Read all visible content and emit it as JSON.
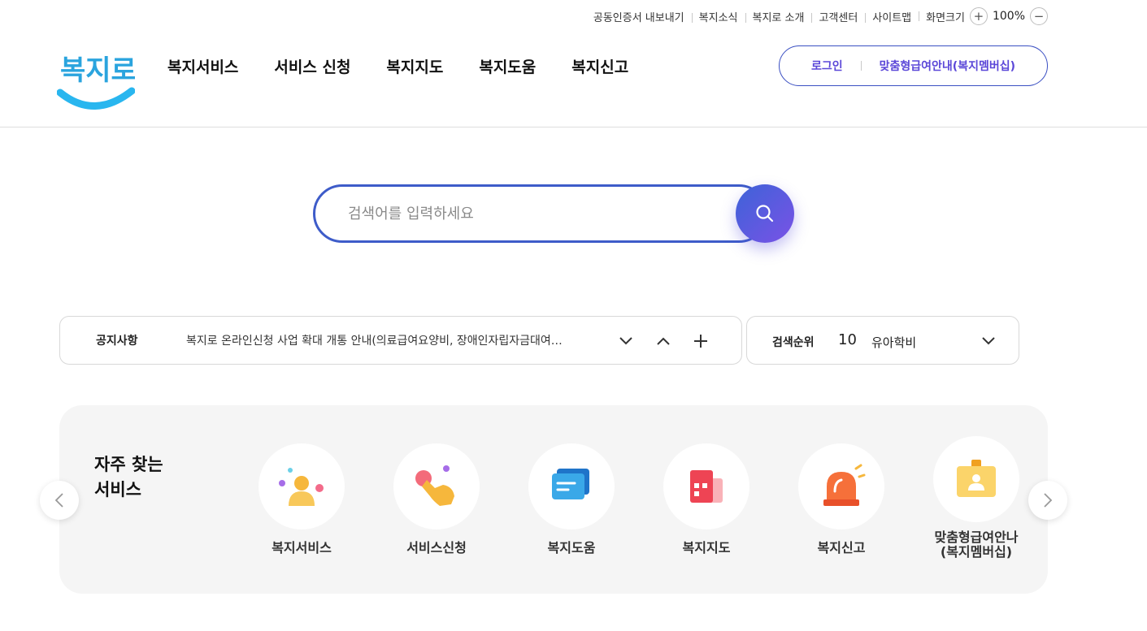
{
  "utility": {
    "items": [
      "공동인증서 내보내기",
      "복지소식",
      "복지로 소개",
      "고객센터",
      "사이트맵"
    ],
    "zoom_label": "화면크기",
    "zoom_in": "+",
    "zoom_value": "100%",
    "zoom_out": "−"
  },
  "logo": {
    "text": "복지로"
  },
  "gnb": [
    "복지서비스",
    "서비스 신청",
    "복지지도",
    "복지도움",
    "복지신고"
  ],
  "account": {
    "login": "로그인",
    "membership": "맞춤형급여안내(복지멤버십)"
  },
  "search": {
    "placeholder": "검색어를 입력하세요",
    "icon": "search-icon"
  },
  "notice": {
    "label": "공지사항",
    "text": "복지로 온라인신청 사업 확대 개통 안내(의료급여요양비, 장애인자립자금대여…"
  },
  "rank": {
    "label": "검색순위",
    "number": "10",
    "keyword": "유아학비"
  },
  "frequent": {
    "title_line1": "자주 찾는",
    "title_line2": "서비스",
    "items": [
      {
        "label": "복지서비스",
        "icon": "person-icon"
      },
      {
        "label": "서비스신청",
        "icon": "hand-pointer-icon"
      },
      {
        "label": "복지도움",
        "icon": "chat-card-icon"
      },
      {
        "label": "복지지도",
        "icon": "building-map-icon"
      },
      {
        "label": "복지신고",
        "icon": "siren-icon"
      },
      {
        "label_line1": "맞춤형급여안나",
        "label_line2": "(복지멤버십)",
        "icon": "membership-card-icon"
      }
    ]
  },
  "colors": {
    "primary": "#3e5cc9",
    "accent": "#7a52e6",
    "logo_blue": "#29a6e0"
  }
}
